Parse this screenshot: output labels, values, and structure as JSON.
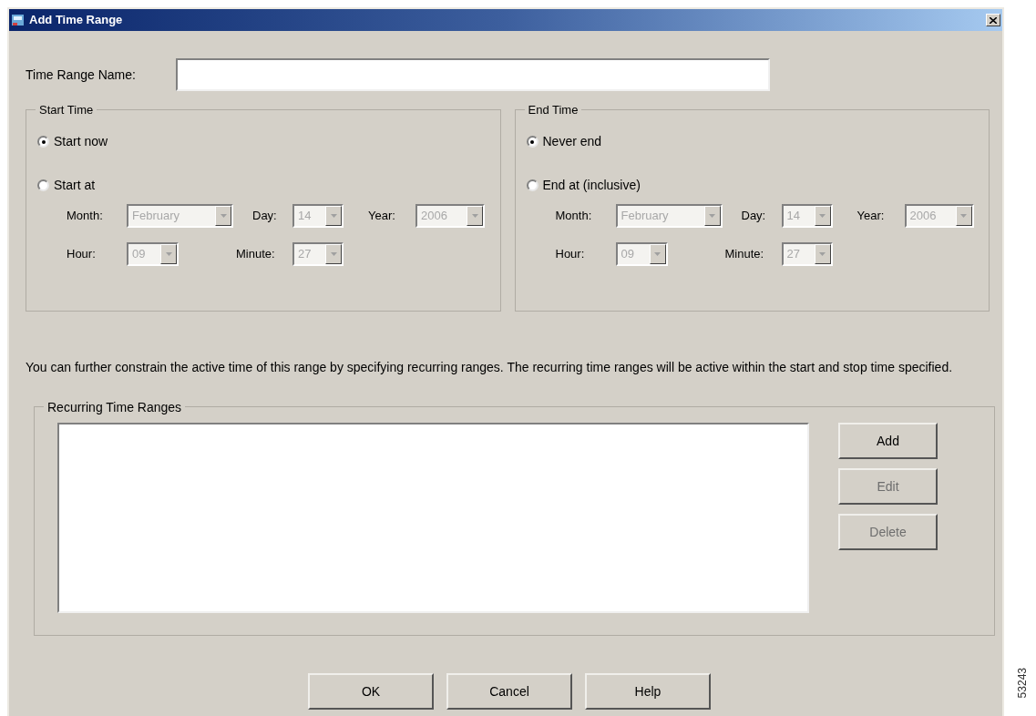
{
  "window": {
    "title": "Add Time Range"
  },
  "name_field": {
    "label": "Time Range Name:"
  },
  "groups": [
    {
      "title": "Start Time",
      "options": [
        {
          "label": "Start now",
          "selected": true
        },
        {
          "label": "Start at",
          "selected": false
        }
      ],
      "date_row": [
        {
          "label": "Month:",
          "value": "February",
          "disabled": true
        },
        {
          "label": "Day:",
          "value": "14",
          "disabled": true
        },
        {
          "label": "Year:",
          "value": "2006",
          "disabled": true
        }
      ],
      "time_row": [
        {
          "label": "Hour:",
          "value": "09",
          "disabled": true
        },
        {
          "label": "Minute:",
          "value": "27",
          "disabled": true
        }
      ]
    },
    {
      "title": "End Time",
      "options": [
        {
          "label": "Never end",
          "selected": true
        },
        {
          "label": "End at (inclusive)",
          "selected": false
        }
      ],
      "date_row": [
        {
          "label": "Month:",
          "value": "February",
          "disabled": true
        },
        {
          "label": "Day:",
          "value": "14",
          "disabled": true
        },
        {
          "label": "Year:",
          "value": "2006",
          "disabled": true
        }
      ],
      "time_row": [
        {
          "label": "Hour:",
          "value": "09",
          "disabled": true
        },
        {
          "label": "Minute:",
          "value": "27",
          "disabled": true
        }
      ]
    }
  ],
  "description": "You can further constrain the active time of this range by specifying recurring ranges.  The recurring time ranges will be active within the start and stop time specified.",
  "recurring": {
    "title": "Recurring Time Ranges",
    "buttons": [
      {
        "label": "Add",
        "disabled": false
      },
      {
        "label": "Edit",
        "disabled": true
      },
      {
        "label": "Delete",
        "disabled": true
      }
    ]
  },
  "footer_buttons": [
    {
      "label": "OK"
    },
    {
      "label": "Cancel"
    },
    {
      "label": "Help"
    }
  ],
  "figure_number": "53243"
}
